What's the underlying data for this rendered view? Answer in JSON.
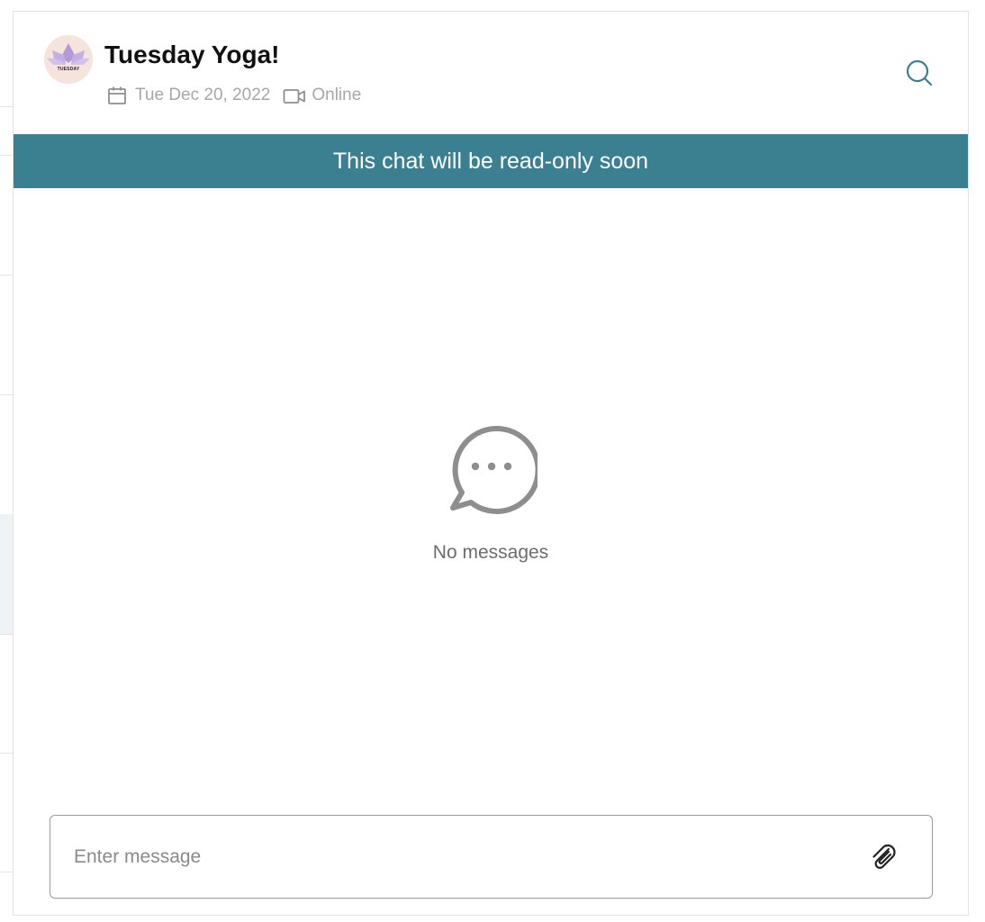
{
  "chat": {
    "title": "Tuesday Yoga!",
    "avatar_label": "TUESDAY",
    "date": "Tue Dec 20, 2022",
    "location": "Online",
    "banner": "This chat will be read-only soon",
    "empty_text": "No messages"
  },
  "composer": {
    "placeholder": "Enter message",
    "value": ""
  },
  "icons": {
    "search": "search-icon",
    "calendar": "calendar-icon",
    "video": "video-camera-icon",
    "chat_bubble": "chat-bubble-icon",
    "attach": "paperclip-icon"
  },
  "colors": {
    "accent": "#3b8091",
    "avatar_lotus": "#b49ad8",
    "avatar_bg": "#f6e4dc",
    "muted_text": "#a7a7a7"
  }
}
